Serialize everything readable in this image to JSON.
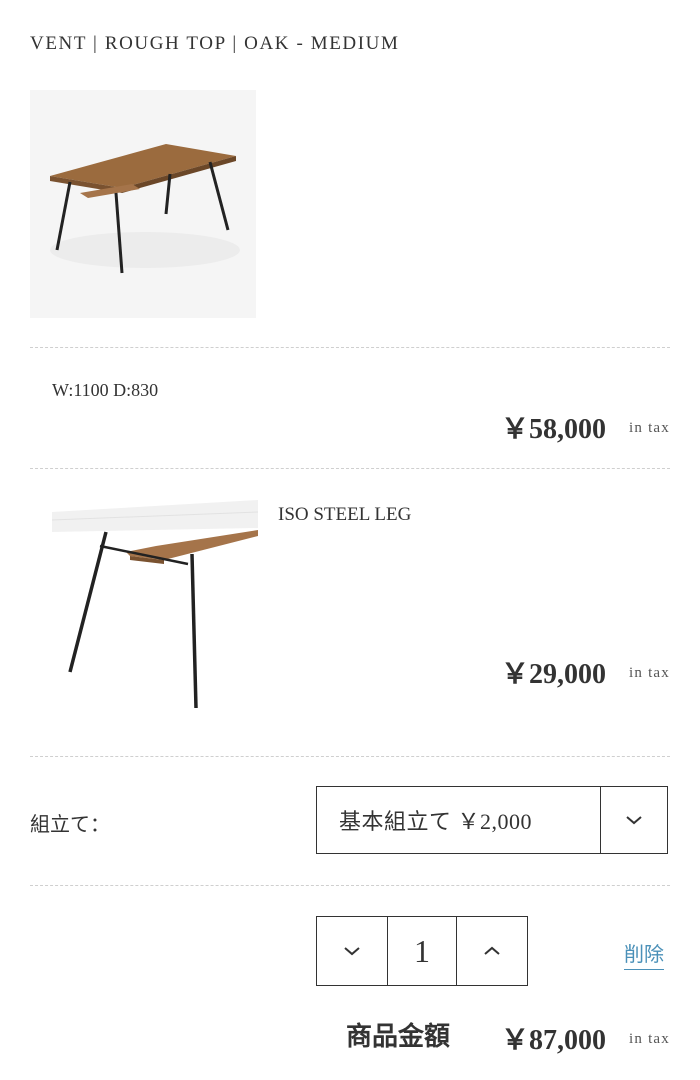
{
  "product": {
    "title": "VENT | ROUGH TOP | OAK - MEDIUM"
  },
  "top_item": {
    "dimensions": "W:1100 D:830",
    "price": "￥58,000",
    "tax_note": "in tax"
  },
  "leg_item": {
    "name": "ISO STEEL LEG",
    "price": "￥29,000",
    "tax_note": "in tax"
  },
  "assembly": {
    "label": "組立て：",
    "selected_option": "基本組立て ￥2,000",
    "dropdown_icon": "chevron-down-icon"
  },
  "quantity": {
    "value": "1",
    "decrement_icon": "chevron-down-icon",
    "increment_icon": "chevron-up-icon"
  },
  "delete_label": "削除",
  "total": {
    "label": "商品金額",
    "price": "￥87,000",
    "tax_note": "in tax"
  },
  "colors": {
    "text": "#333333",
    "link": "#4a90b8",
    "divider": "#cfcfcf"
  }
}
